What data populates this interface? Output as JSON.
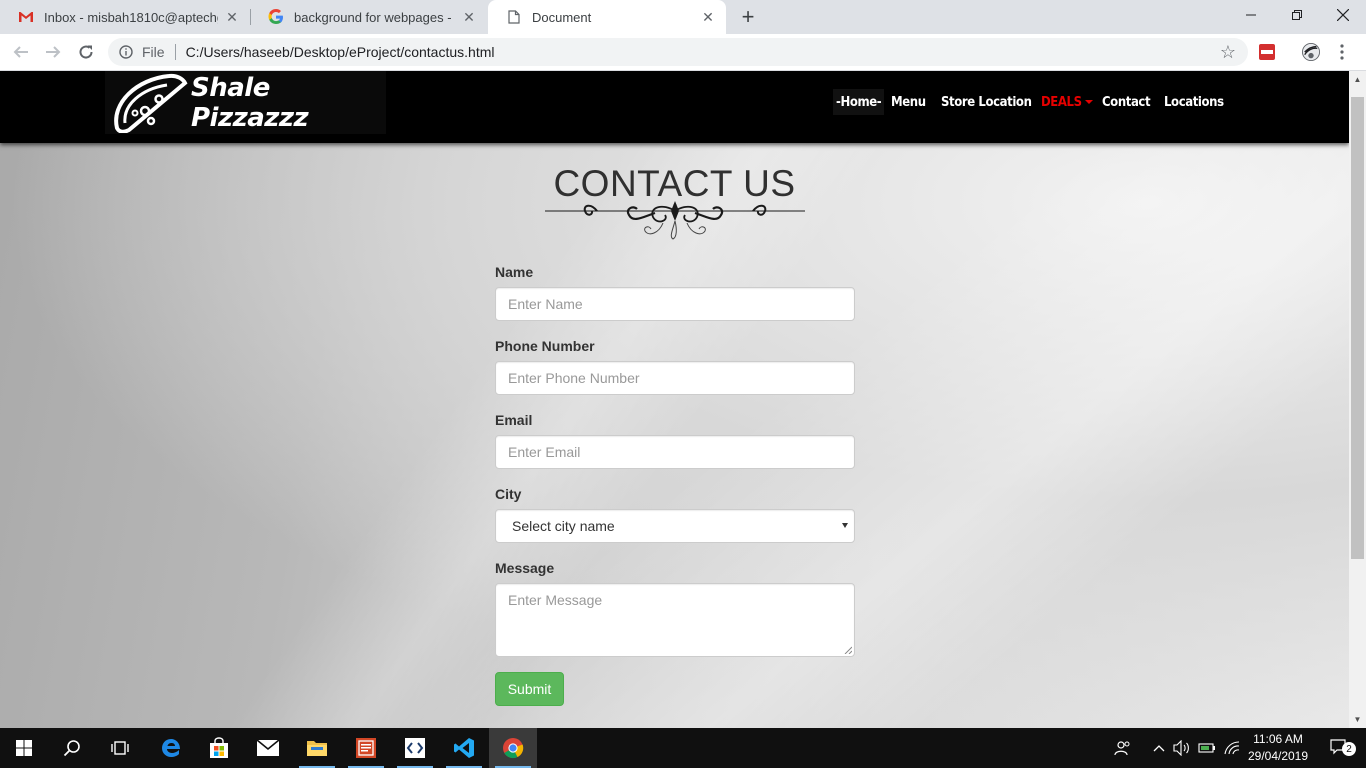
{
  "browser": {
    "tabs": [
      {
        "title": "Inbox - misbah1810c@aptechgdn",
        "favicon": "gmail-icon",
        "active": false
      },
      {
        "title": "background for webpages - Goo",
        "favicon": "google-icon",
        "active": false
      },
      {
        "title": "Document",
        "favicon": "page-icon",
        "active": true
      }
    ],
    "scheme_label": "File",
    "url": "C:/Users/haseeb/Desktop/eProject/contactus.html"
  },
  "site": {
    "brand": "Shale Pizzazzz",
    "nav": {
      "home": "-Home-",
      "menu": "Menu",
      "store_location": "Store Location",
      "deals": "DEALS",
      "contact": "Contact",
      "locations": "Locations"
    },
    "deals_color": "#e60000"
  },
  "contact": {
    "heading": "CONTACT US",
    "name_label": "Name",
    "name_placeholder": "Enter Name",
    "phone_label": "Phone Number",
    "phone_placeholder": "Enter Phone Number",
    "email_label": "Email",
    "email_placeholder": "Enter Email",
    "city_label": "City",
    "city_selected": "Select city name",
    "message_label": "Message",
    "message_placeholder": "Enter Message",
    "submit_label": "Submit",
    "submit_color": "#5cb85c"
  },
  "taskbar": {
    "time": "11:06 AM",
    "date": "29/04/2019",
    "notification_count": "2"
  }
}
